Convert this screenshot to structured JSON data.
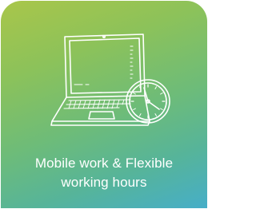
{
  "tile": {
    "caption_line1": "Mobile work & Flexible",
    "caption_line2": "working hours",
    "icon": "laptop-with-clock-icon",
    "gradient_colors": [
      "#a9c64a",
      "#8cc25a",
      "#6ebc78",
      "#56b49a",
      "#46aec8"
    ],
    "text_color": "#ffffff"
  }
}
